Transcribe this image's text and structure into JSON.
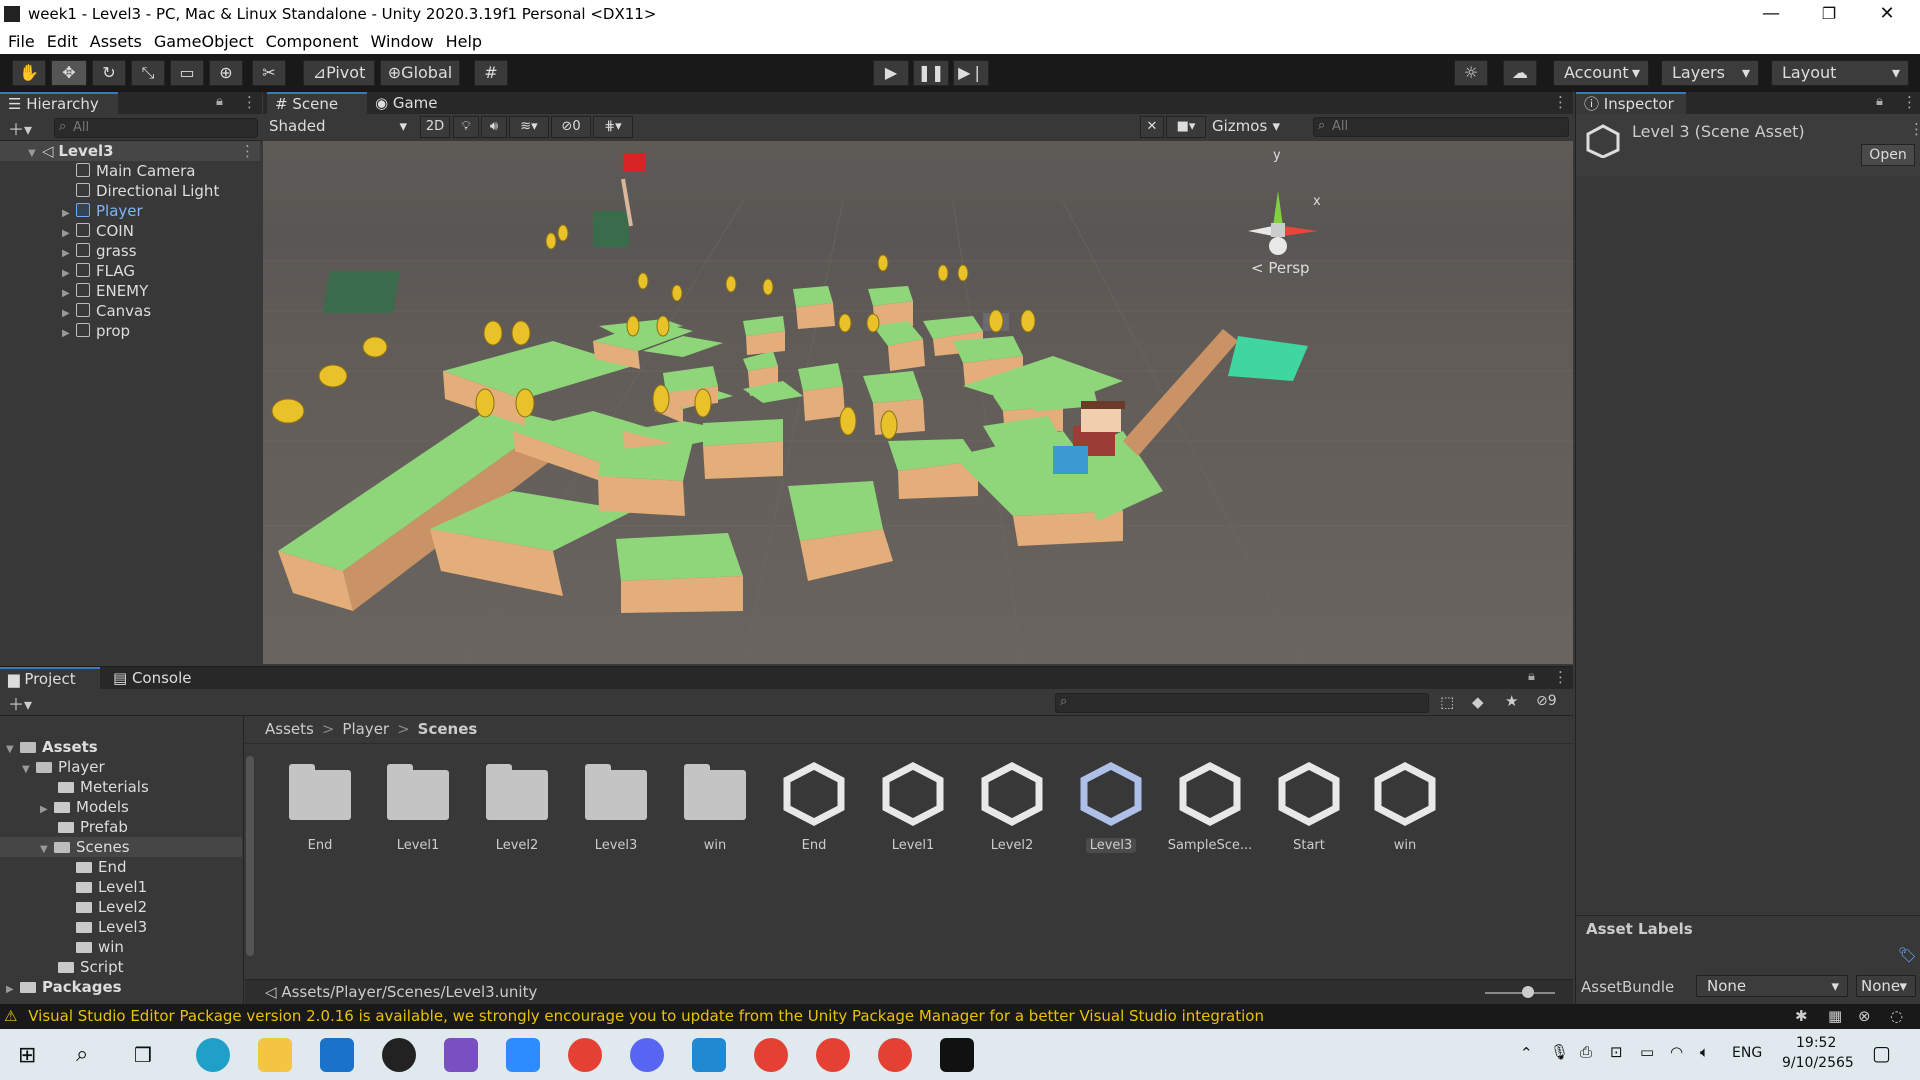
{
  "window": {
    "title": "week1 - Level3 - PC, Mac & Linux Standalone - Unity 2020.3.19f1 Personal <DX11>",
    "controls": [
      "—",
      "❐",
      "✕"
    ]
  },
  "menu": [
    "File",
    "Edit",
    "Assets",
    "GameObject",
    "Component",
    "Window",
    "Help"
  ],
  "toolbar": {
    "pivot": "Pivot",
    "global": "Global",
    "account": "Account",
    "layers": "Layers",
    "layout": "Layout"
  },
  "hierarchy": {
    "tab": "Hierarchy",
    "search_placeholder": "All",
    "scene": "Level3",
    "items": [
      "Main Camera",
      "Directional Light",
      "Player",
      "COIN",
      "grass",
      "FLAG",
      "ENEMY",
      "Canvas",
      "prop"
    ]
  },
  "scene": {
    "tabs": [
      "Scene",
      "Game"
    ],
    "shading": "Shaded",
    "mode2d": "2D",
    "hidden_count": "0",
    "gizmos": "Gizmos",
    "search_placeholder": "All",
    "axis_y": "y",
    "axis_x": "x",
    "persp": "< Persp"
  },
  "inspector": {
    "tab": "Inspector",
    "title": "Level 3 (Scene Asset)",
    "open": "Open",
    "asset_labels": "Asset Labels",
    "assetbundle_label": "AssetBundle",
    "assetbundle_value": "None",
    "assetbundle_variant": "None"
  },
  "project": {
    "tabs": [
      "Project",
      "Console"
    ],
    "breadcrumb": [
      "Assets",
      "Player",
      "Scenes"
    ],
    "hidden_count": "9",
    "tree": {
      "assets": "Assets",
      "player": "Player",
      "materials": "Meterials",
      "models": "Models",
      "prefab": "Prefab",
      "scenes": "Scenes",
      "end": "End",
      "level1": "Level1",
      "level2": "Level2",
      "level3": "Level3",
      "win": "win",
      "script": "Script",
      "packages": "Packages"
    },
    "assets": [
      {
        "name": "End",
        "kind": "folder"
      },
      {
        "name": "Level1",
        "kind": "folder"
      },
      {
        "name": "Level2",
        "kind": "folder"
      },
      {
        "name": "Level3",
        "kind": "folder"
      },
      {
        "name": "win",
        "kind": "folder"
      },
      {
        "name": "End",
        "kind": "scene"
      },
      {
        "name": "Level1",
        "kind": "scene"
      },
      {
        "name": "Level2",
        "kind": "scene"
      },
      {
        "name": "Level3",
        "kind": "scene"
      },
      {
        "name": "SampleSce...",
        "kind": "scene"
      },
      {
        "name": "Start",
        "kind": "scene"
      },
      {
        "name": "win",
        "kind": "scene"
      }
    ],
    "path": "Assets/Player/Scenes/Level3.unity"
  },
  "status": "Visual Studio Editor Package version 2.0.16 is available, we strongly encourage you to update from the Unity Package Manager for a better Visual Studio integration",
  "taskbar": {
    "lang": "ENG",
    "time": "19:52",
    "date": "9/10/2565"
  },
  "colors": {
    "accent": "#3a79bb",
    "grass": "#8fd67a",
    "dirt": "#e6b27e",
    "coin": "#e8c228",
    "warning": "#e8c200"
  }
}
